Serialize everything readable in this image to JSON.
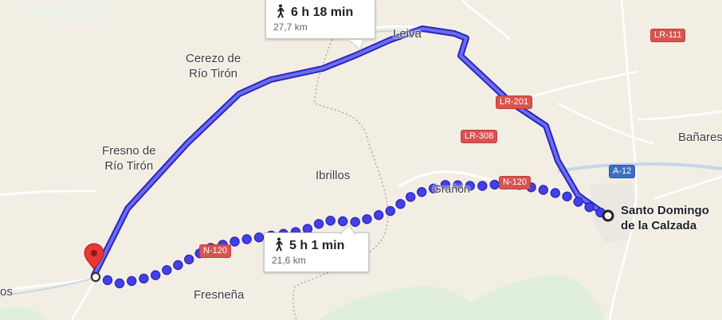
{
  "places": {
    "cerezo": "Cerezo de\nRío Tirón",
    "leiva": "Leiva",
    "fresno": "Fresno de\nRío Tirón",
    "ibrillos": "Ibrillos",
    "granon": "Grañón",
    "fresnena": "Fresneña",
    "banares": "Bañares",
    "los": "os",
    "destination": "Santo Domingo\nde la Calzada"
  },
  "roads": {
    "lr111": "LR-111",
    "lr201": "LR-201",
    "lr308": "LR-308",
    "n120_east": "N-120",
    "n120_west": "N-120",
    "a12": "A-12"
  },
  "routes": {
    "alt": {
      "duration": "6 h 18 min",
      "distance": "27,7 km",
      "mode_icon": "walking-person-icon"
    },
    "main": {
      "duration": "5 h 1 min",
      "distance": "21,6 km",
      "mode_icon": "walking-person-icon"
    }
  },
  "colors": {
    "route": "#4340e6",
    "route_outline": "#2a26b8",
    "shield_red": "#d9534f",
    "shield_blue": "#3b6fc4",
    "pin": "#e53935"
  }
}
